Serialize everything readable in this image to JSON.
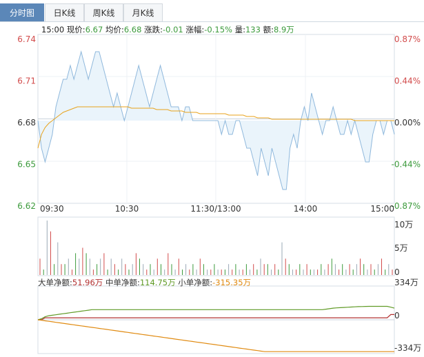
{
  "tabs": [
    {
      "label": "分时图",
      "active": true
    },
    {
      "label": "日K线",
      "active": false
    },
    {
      "label": "周K线",
      "active": false
    },
    {
      "label": "月K线",
      "active": false
    }
  ],
  "quote": {
    "time": "15:00",
    "price_label": "现价:",
    "price": "6.67",
    "avg_label": "均价:",
    "avg": "6.68",
    "change_label": "涨跌:",
    "change": "-0.01",
    "pct_label": "涨幅:",
    "pct": "-0.15%",
    "vol_label": "量:",
    "vol": "133",
    "amt_label": "额:",
    "amt": "8.9万"
  },
  "netflow": {
    "large_label": "大单净额:",
    "large": "51.96万",
    "medium_label": "中单净额:",
    "medium": "114.75万",
    "small_label": "小单净额:",
    "small": "-315.35万"
  },
  "colors": {
    "up": "#d24b4b",
    "down": "#3b9a3b",
    "price": "#8fb8dc",
    "avg": "#e8a21a",
    "large": "#b23030",
    "medium": "#5f9a25",
    "small": "#e08a10"
  },
  "chart_data": [
    {
      "type": "line",
      "y_labels_left": [
        "6.74",
        "6.71",
        "6.68",
        "6.65",
        "6.62"
      ],
      "y_labels_right": [
        "0.87%",
        "0.44%",
        "0.00%",
        "-0.44%",
        "-0.87%"
      ],
      "ylim": [
        6.62,
        6.74
      ],
      "x_labels": [
        "09:30",
        "10:30",
        "11:30/13:00",
        "14:00",
        "15:00"
      ],
      "series": [
        {
          "values": [
            6.68,
            6.66,
            6.65,
            6.66,
            6.67,
            6.69,
            6.7,
            6.71,
            6.71,
            6.72,
            6.71,
            6.72,
            6.73,
            6.72,
            6.71,
            6.72,
            6.73,
            6.73,
            6.72,
            6.71,
            6.7,
            6.69,
            6.7,
            6.69,
            6.68,
            6.69,
            6.7,
            6.71,
            6.72,
            6.71,
            6.7,
            6.69,
            6.7,
            6.71,
            6.72,
            6.71,
            6.7,
            6.69,
            6.69,
            6.69,
            6.68,
            6.69,
            6.69,
            6.68,
            6.68,
            6.68,
            6.68,
            6.68,
            6.68,
            6.68,
            6.68,
            6.67,
            6.68,
            6.67,
            6.67,
            6.68,
            6.68,
            6.67,
            6.66,
            6.66,
            6.65,
            6.64,
            6.66,
            6.65,
            6.64,
            6.66,
            6.65,
            6.64,
            6.63,
            6.63,
            6.66,
            6.67,
            6.66,
            6.68,
            6.69,
            6.68,
            6.7,
            6.69,
            6.68,
            6.67,
            6.68,
            6.68,
            6.69,
            6.68,
            6.67,
            6.67,
            6.68,
            6.67,
            6.68,
            6.67,
            6.66,
            6.65,
            6.65,
            6.67,
            6.68,
            6.68,
            6.67,
            6.68,
            6.68,
            6.67
          ]
        },
        {
          "values": [
            6.66,
            6.67,
            6.675,
            6.678,
            6.68,
            6.682,
            6.684,
            6.686,
            6.687,
            6.688,
            6.689,
            6.69,
            6.69,
            6.69,
            6.69,
            6.69,
            6.69,
            6.69,
            6.69,
            6.69,
            6.69,
            6.69,
            6.69,
            6.69,
            6.69,
            6.69,
            6.689,
            6.689,
            6.689,
            6.689,
            6.689,
            6.689,
            6.689,
            6.688,
            6.688,
            6.688,
            6.688,
            6.687,
            6.687,
            6.687,
            6.687,
            6.686,
            6.686,
            6.686,
            6.686,
            6.685,
            6.685,
            6.685,
            6.685,
            6.685,
            6.685,
            6.685,
            6.685,
            6.684,
            6.684,
            6.684,
            6.684,
            6.684,
            6.683,
            6.683,
            6.683,
            6.682,
            6.682,
            6.682,
            6.682,
            6.681,
            6.681,
            6.681,
            6.681,
            6.681,
            6.681,
            6.681,
            6.681,
            6.681,
            6.681,
            6.681,
            6.681,
            6.681,
            6.681,
            6.681,
            6.681,
            6.681,
            6.681,
            6.681,
            6.681,
            6.681,
            6.681,
            6.681,
            6.68,
            6.68,
            6.68,
            6.68,
            6.68,
            6.68,
            6.68,
            6.68,
            6.68,
            6.68,
            6.68,
            6.68
          ]
        }
      ]
    },
    {
      "type": "bar",
      "y_labels_right": [
        "10万",
        "5万",
        "0"
      ],
      "ylim": [
        0,
        10
      ],
      "values": [
        3,
        1,
        10,
        8,
        2,
        6,
        2,
        2,
        3,
        1,
        4,
        3,
        5,
        4,
        3,
        1,
        2,
        3,
        4,
        1,
        3,
        2,
        1,
        3,
        2,
        1,
        2,
        4,
        3,
        2,
        1,
        2,
        1,
        3,
        2,
        1,
        4,
        2,
        1,
        3,
        1,
        2,
        1,
        2,
        1,
        3,
        2,
        1,
        1,
        2,
        1,
        1,
        1,
        2,
        1,
        2,
        1,
        1,
        2,
        1,
        2,
        1,
        3,
        2,
        2,
        1,
        2,
        1,
        6,
        3,
        2,
        1,
        1,
        2,
        1,
        2,
        1,
        1,
        1,
        2,
        1,
        2,
        3,
        2,
        1,
        2,
        1,
        2,
        1,
        2,
        3,
        2,
        1,
        2,
        1,
        2,
        3,
        1,
        2,
        1
      ]
    },
    {
      "type": "line",
      "y_labels_right": [
        "334万",
        "0",
        "-334万"
      ],
      "ylim": [
        -334,
        334
      ],
      "series": [
        {
          "name": "大单净额",
          "values": [
            0,
            0,
            20,
            20,
            20,
            20,
            20,
            20,
            20,
            20,
            20,
            20,
            20,
            20,
            20,
            20,
            20,
            20,
            20,
            20,
            20,
            20,
            20,
            20,
            20,
            20,
            20,
            20,
            20,
            20,
            20,
            20,
            20,
            20,
            20,
            20,
            20,
            20,
            20,
            20,
            20,
            20,
            20,
            20,
            20,
            20,
            20,
            20,
            20,
            20,
            20,
            20,
            20,
            20,
            20,
            20,
            20,
            20,
            20,
            20,
            20,
            20,
            20,
            20,
            20,
            20,
            20,
            20,
            20,
            20,
            20,
            20,
            20,
            20,
            20,
            20,
            20,
            20,
            20,
            20,
            20,
            20,
            20,
            20,
            20,
            20,
            20,
            20,
            20,
            20,
            20,
            20,
            20,
            20,
            20,
            20,
            20,
            20,
            52,
            52
          ]
        },
        {
          "name": "中单净额",
          "values": [
            0,
            10,
            30,
            40,
            45,
            50,
            55,
            60,
            65,
            70,
            75,
            80,
            85,
            90,
            95,
            100,
            100,
            100,
            100,
            100,
            100,
            100,
            100,
            100,
            100,
            100,
            100,
            100,
            100,
            100,
            100,
            100,
            100,
            100,
            100,
            100,
            100,
            100,
            100,
            100,
            100,
            100,
            100,
            100,
            100,
            100,
            100,
            100,
            100,
            100,
            100,
            100,
            100,
            100,
            100,
            100,
            100,
            100,
            100,
            100,
            100,
            100,
            100,
            100,
            100,
            100,
            100,
            100,
            100,
            100,
            100,
            100,
            100,
            100,
            100,
            100,
            100,
            100,
            100,
            100,
            105,
            110,
            115,
            118,
            120,
            122,
            124,
            126,
            128,
            130,
            131,
            132,
            133,
            133,
            133,
            133,
            133,
            133,
            125,
            115
          ]
        },
        {
          "name": "小单净额",
          "values": [
            0,
            -5,
            -10,
            -15,
            -20,
            -25,
            -30,
            -35,
            -40,
            -45,
            -50,
            -55,
            -60,
            -65,
            -70,
            -75,
            -80,
            -85,
            -90,
            -95,
            -100,
            -105,
            -110,
            -115,
            -120,
            -125,
            -130,
            -135,
            -140,
            -145,
            -150,
            -155,
            -160,
            -165,
            -170,
            -175,
            -180,
            -185,
            -190,
            -195,
            -200,
            -205,
            -210,
            -215,
            -220,
            -225,
            -230,
            -235,
            -240,
            -245,
            -250,
            -255,
            -260,
            -265,
            -270,
            -275,
            -280,
            -285,
            -290,
            -295,
            -300,
            -305,
            -310,
            -315,
            -315,
            -315,
            -315,
            -315,
            -315,
            -315,
            -315,
            -315,
            -315,
            -315,
            -315,
            -315,
            -315,
            -315,
            -315,
            -315,
            -315,
            -315,
            -315,
            -315,
            -315,
            -315,
            -315,
            -315,
            -315,
            -315,
            -315,
            -315,
            -315,
            -315,
            -315,
            -315,
            -315,
            -315,
            -315,
            -315
          ]
        }
      ]
    }
  ]
}
